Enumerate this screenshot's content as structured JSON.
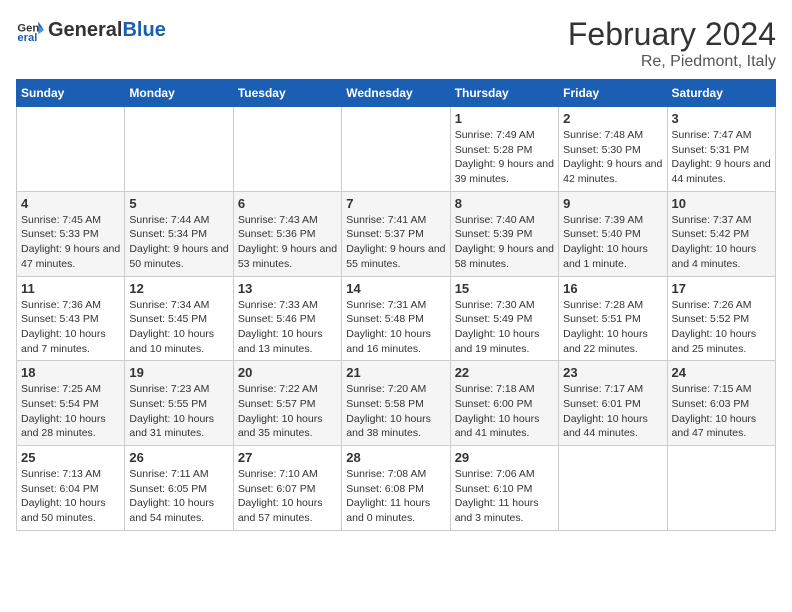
{
  "header": {
    "logo_general": "General",
    "logo_blue": "Blue",
    "main_title": "February 2024",
    "subtitle": "Re, Piedmont, Italy"
  },
  "days_of_week": [
    "Sunday",
    "Monday",
    "Tuesday",
    "Wednesday",
    "Thursday",
    "Friday",
    "Saturday"
  ],
  "weeks": [
    [
      {
        "day": "",
        "detail": ""
      },
      {
        "day": "",
        "detail": ""
      },
      {
        "day": "",
        "detail": ""
      },
      {
        "day": "",
        "detail": ""
      },
      {
        "day": "1",
        "detail": "Sunrise: 7:49 AM\nSunset: 5:28 PM\nDaylight: 9 hours\nand 39 minutes."
      },
      {
        "day": "2",
        "detail": "Sunrise: 7:48 AM\nSunset: 5:30 PM\nDaylight: 9 hours\nand 42 minutes."
      },
      {
        "day": "3",
        "detail": "Sunrise: 7:47 AM\nSunset: 5:31 PM\nDaylight: 9 hours\nand 44 minutes."
      }
    ],
    [
      {
        "day": "4",
        "detail": "Sunrise: 7:45 AM\nSunset: 5:33 PM\nDaylight: 9 hours\nand 47 minutes."
      },
      {
        "day": "5",
        "detail": "Sunrise: 7:44 AM\nSunset: 5:34 PM\nDaylight: 9 hours\nand 50 minutes."
      },
      {
        "day": "6",
        "detail": "Sunrise: 7:43 AM\nSunset: 5:36 PM\nDaylight: 9 hours\nand 53 minutes."
      },
      {
        "day": "7",
        "detail": "Sunrise: 7:41 AM\nSunset: 5:37 PM\nDaylight: 9 hours\nand 55 minutes."
      },
      {
        "day": "8",
        "detail": "Sunrise: 7:40 AM\nSunset: 5:39 PM\nDaylight: 9 hours\nand 58 minutes."
      },
      {
        "day": "9",
        "detail": "Sunrise: 7:39 AM\nSunset: 5:40 PM\nDaylight: 10 hours\nand 1 minute."
      },
      {
        "day": "10",
        "detail": "Sunrise: 7:37 AM\nSunset: 5:42 PM\nDaylight: 10 hours\nand 4 minutes."
      }
    ],
    [
      {
        "day": "11",
        "detail": "Sunrise: 7:36 AM\nSunset: 5:43 PM\nDaylight: 10 hours\nand 7 minutes."
      },
      {
        "day": "12",
        "detail": "Sunrise: 7:34 AM\nSunset: 5:45 PM\nDaylight: 10 hours\nand 10 minutes."
      },
      {
        "day": "13",
        "detail": "Sunrise: 7:33 AM\nSunset: 5:46 PM\nDaylight: 10 hours\nand 13 minutes."
      },
      {
        "day": "14",
        "detail": "Sunrise: 7:31 AM\nSunset: 5:48 PM\nDaylight: 10 hours\nand 16 minutes."
      },
      {
        "day": "15",
        "detail": "Sunrise: 7:30 AM\nSunset: 5:49 PM\nDaylight: 10 hours\nand 19 minutes."
      },
      {
        "day": "16",
        "detail": "Sunrise: 7:28 AM\nSunset: 5:51 PM\nDaylight: 10 hours\nand 22 minutes."
      },
      {
        "day": "17",
        "detail": "Sunrise: 7:26 AM\nSunset: 5:52 PM\nDaylight: 10 hours\nand 25 minutes."
      }
    ],
    [
      {
        "day": "18",
        "detail": "Sunrise: 7:25 AM\nSunset: 5:54 PM\nDaylight: 10 hours\nand 28 minutes."
      },
      {
        "day": "19",
        "detail": "Sunrise: 7:23 AM\nSunset: 5:55 PM\nDaylight: 10 hours\nand 31 minutes."
      },
      {
        "day": "20",
        "detail": "Sunrise: 7:22 AM\nSunset: 5:57 PM\nDaylight: 10 hours\nand 35 minutes."
      },
      {
        "day": "21",
        "detail": "Sunrise: 7:20 AM\nSunset: 5:58 PM\nDaylight: 10 hours\nand 38 minutes."
      },
      {
        "day": "22",
        "detail": "Sunrise: 7:18 AM\nSunset: 6:00 PM\nDaylight: 10 hours\nand 41 minutes."
      },
      {
        "day": "23",
        "detail": "Sunrise: 7:17 AM\nSunset: 6:01 PM\nDaylight: 10 hours\nand 44 minutes."
      },
      {
        "day": "24",
        "detail": "Sunrise: 7:15 AM\nSunset: 6:03 PM\nDaylight: 10 hours\nand 47 minutes."
      }
    ],
    [
      {
        "day": "25",
        "detail": "Sunrise: 7:13 AM\nSunset: 6:04 PM\nDaylight: 10 hours\nand 50 minutes."
      },
      {
        "day": "26",
        "detail": "Sunrise: 7:11 AM\nSunset: 6:05 PM\nDaylight: 10 hours\nand 54 minutes."
      },
      {
        "day": "27",
        "detail": "Sunrise: 7:10 AM\nSunset: 6:07 PM\nDaylight: 10 hours\nand 57 minutes."
      },
      {
        "day": "28",
        "detail": "Sunrise: 7:08 AM\nSunset: 6:08 PM\nDaylight: 11 hours\nand 0 minutes."
      },
      {
        "day": "29",
        "detail": "Sunrise: 7:06 AM\nSunset: 6:10 PM\nDaylight: 11 hours\nand 3 minutes."
      },
      {
        "day": "",
        "detail": ""
      },
      {
        "day": "",
        "detail": ""
      }
    ]
  ]
}
